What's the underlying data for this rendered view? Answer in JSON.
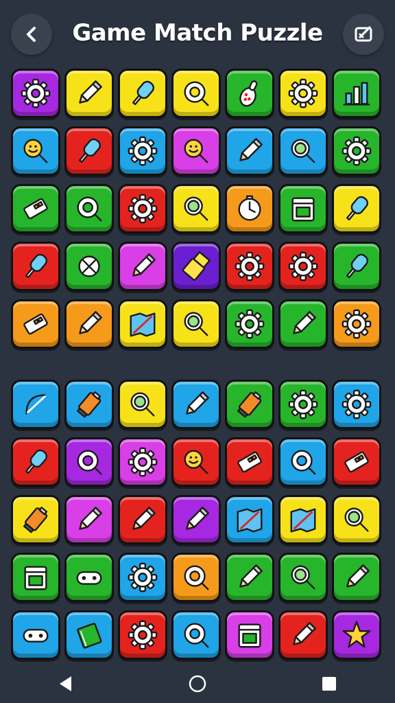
{
  "header": {
    "title": "Game Match Puzzle",
    "back_icon": "chevron-left-icon",
    "edit_icon": "edit-square-icon"
  },
  "palette": {
    "purple": "#a628e0",
    "yellow": "#f7e21a",
    "green": "#27b52c",
    "blue": "#1fa5e8",
    "red": "#e4231f",
    "orange": "#f59a1a",
    "magenta": "#d93fe6",
    "violet": "#6a1fd0"
  },
  "board_top": [
    [
      {
        "color": "purple",
        "icon": "gear"
      },
      {
        "color": "yellow",
        "icon": "pencil"
      },
      {
        "color": "yellow",
        "icon": "popsicle"
      },
      {
        "color": "yellow",
        "icon": "ring"
      },
      {
        "color": "green",
        "icon": "bowling-pin"
      },
      {
        "color": "yellow",
        "icon": "gear"
      },
      {
        "color": "green",
        "icon": "bar-chart"
      }
    ],
    [
      {
        "color": "blue",
        "icon": "magnifier-face"
      },
      {
        "color": "red",
        "icon": "popsicle"
      },
      {
        "color": "blue",
        "icon": "gear"
      },
      {
        "color": "magenta",
        "icon": "magnifier-face"
      },
      {
        "color": "blue",
        "icon": "pencil"
      },
      {
        "color": "blue",
        "icon": "magnifier"
      },
      {
        "color": "green",
        "icon": "gear"
      }
    ],
    [
      {
        "color": "green",
        "icon": "eraser"
      },
      {
        "color": "green",
        "icon": "ring"
      },
      {
        "color": "red",
        "icon": "gear"
      },
      {
        "color": "yellow",
        "icon": "magnifier"
      },
      {
        "color": "orange",
        "icon": "clock"
      },
      {
        "color": "green",
        "icon": "calendar"
      },
      {
        "color": "yellow",
        "icon": "popsicle"
      }
    ],
    [
      {
        "color": "red",
        "icon": "popsicle"
      },
      {
        "color": "green",
        "icon": "cross-circle"
      },
      {
        "color": "magenta",
        "icon": "pencil"
      },
      {
        "color": "violet",
        "icon": "usb"
      },
      {
        "color": "red",
        "icon": "gear"
      },
      {
        "color": "red",
        "icon": "gear"
      },
      {
        "color": "green",
        "icon": "popsicle"
      }
    ],
    [
      {
        "color": "orange",
        "icon": "eraser"
      },
      {
        "color": "orange",
        "icon": "pencil"
      },
      {
        "color": "yellow",
        "icon": "map"
      },
      {
        "color": "yellow",
        "icon": "magnifier"
      },
      {
        "color": "green",
        "icon": "gear"
      },
      {
        "color": "green",
        "icon": "pencil"
      },
      {
        "color": "orange",
        "icon": "gear"
      }
    ]
  ],
  "board_bottom": [
    [
      {
        "color": "blue",
        "icon": "bow"
      },
      {
        "color": "blue",
        "icon": "battery"
      },
      {
        "color": "yellow",
        "icon": "magnifier"
      },
      {
        "color": "blue",
        "icon": "pencil"
      },
      {
        "color": "green",
        "icon": "battery"
      },
      {
        "color": "green",
        "icon": "gear"
      },
      {
        "color": "blue",
        "icon": "gear"
      }
    ],
    [
      {
        "color": "red",
        "icon": "popsicle"
      },
      {
        "color": "purple",
        "icon": "ring"
      },
      {
        "color": "magenta",
        "icon": "gear"
      },
      {
        "color": "red",
        "icon": "magnifier-face"
      },
      {
        "color": "red",
        "icon": "eraser"
      },
      {
        "color": "blue",
        "icon": "ring"
      },
      {
        "color": "red",
        "icon": "eraser"
      }
    ],
    [
      {
        "color": "yellow",
        "icon": "battery"
      },
      {
        "color": "magenta",
        "icon": "pencil"
      },
      {
        "color": "red",
        "icon": "pencil"
      },
      {
        "color": "purple",
        "icon": "pencil"
      },
      {
        "color": "blue",
        "icon": "map"
      },
      {
        "color": "yellow",
        "icon": "map"
      },
      {
        "color": "yellow",
        "icon": "magnifier"
      }
    ],
    [
      {
        "color": "green",
        "icon": "calendar"
      },
      {
        "color": "green",
        "icon": "gamepad"
      },
      {
        "color": "blue",
        "icon": "gear"
      },
      {
        "color": "orange",
        "icon": "ring"
      },
      {
        "color": "green",
        "icon": "pencil"
      },
      {
        "color": "green",
        "icon": "magnifier"
      },
      {
        "color": "green",
        "icon": "pencil"
      }
    ],
    [
      {
        "color": "blue",
        "icon": "gamepad"
      },
      {
        "color": "blue",
        "icon": "book"
      },
      {
        "color": "red",
        "icon": "gear"
      },
      {
        "color": "blue",
        "icon": "ring"
      },
      {
        "color": "magenta",
        "icon": "calendar"
      },
      {
        "color": "red",
        "icon": "pencil"
      },
      {
        "color": "purple",
        "icon": "star"
      }
    ]
  ],
  "navbar": {
    "back_icon": "triangle-back-icon",
    "home_icon": "circle-home-icon",
    "recents_icon": "square-recents-icon"
  }
}
